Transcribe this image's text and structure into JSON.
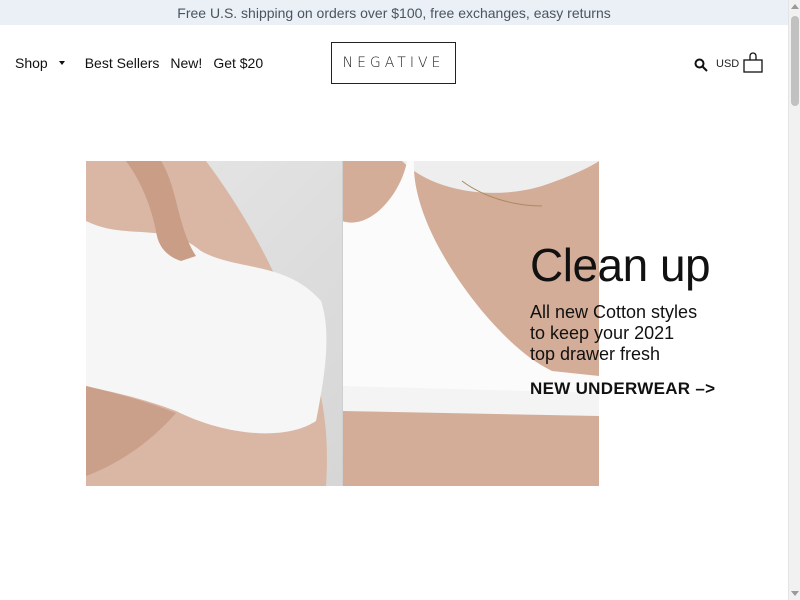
{
  "announcement": "Free U.S. shipping on orders over $100, free exchanges, easy returns",
  "nav": {
    "shop": "Shop",
    "best_sellers": "Best Sellers",
    "new": "New!",
    "get20": "Get $20"
  },
  "logo": "NEGATIVE",
  "header_right": {
    "currency": "USD",
    "search_icon": "search-icon",
    "bag_icon": "shopping-bag-icon"
  },
  "hero": {
    "title": "Clean up",
    "subtitle_lines": [
      "All new Cotton styles",
      "to keep your 2021",
      "top drawer fresh"
    ],
    "cta": "NEW UNDERWEAR –>"
  }
}
